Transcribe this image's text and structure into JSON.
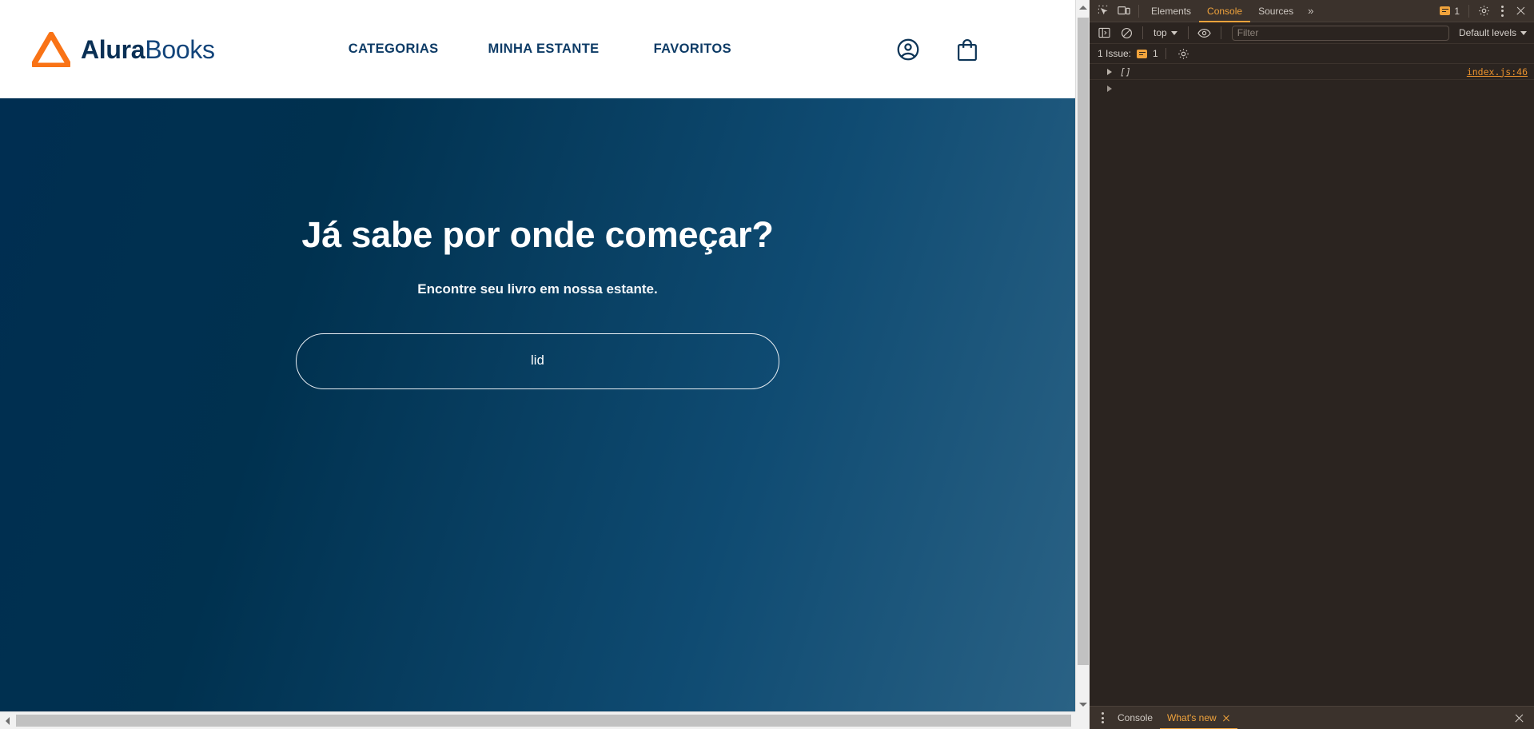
{
  "site": {
    "brand": {
      "part1": "Alura",
      "part2": "Books",
      "logo_icon": "alura-triangle-logo"
    },
    "nav": [
      {
        "label": "CATEGORIAS"
      },
      {
        "label": "MINHA ESTANTE"
      },
      {
        "label": "FAVORITOS"
      }
    ],
    "actions": [
      {
        "icon": "user-account-icon"
      },
      {
        "icon": "shopping-bag-icon"
      }
    ],
    "hero": {
      "title": "Já sabe por onde começar?",
      "subtitle": "Encontre seu livro em nossa estante.",
      "cta_label": "lid",
      "gradient_from": "#002e51",
      "gradient_to": "#2a6285"
    }
  },
  "devtools": {
    "accent": "#f0a33c",
    "background": "#2b2420",
    "toolbar_icons": {
      "inspect": "inspect-element-icon",
      "device": "device-toolbar-icon",
      "settings": "gear-icon",
      "more_options": "kebab-menu-icon",
      "close": "close-icon"
    },
    "tabs": [
      {
        "label": "Elements",
        "active": false
      },
      {
        "label": "Console",
        "active": true
      },
      {
        "label": "Sources",
        "active": false
      }
    ],
    "more_tabs_label": "»",
    "tabbar_issue_count": "1",
    "console_toolbar": {
      "sidebar_icon": "console-sidebar-icon",
      "clear_icon": "clear-console-icon",
      "context_value": "top",
      "eye_icon": "live-expression-eye-icon",
      "filter_placeholder": "Filter",
      "filter_value": "",
      "levels_value": "Default levels"
    },
    "issues_bar": {
      "label": "1 Issue:",
      "count": "1",
      "settings_icon": "gear-icon"
    },
    "console_messages": [
      {
        "value": "[]",
        "source": "index.js:46"
      }
    ],
    "drawer": {
      "tabs": [
        {
          "label": "Console",
          "active": false,
          "closable": false
        },
        {
          "label": "What's new",
          "active": true,
          "closable": true
        }
      ],
      "close_icon": "close-icon",
      "more_icon": "kebab-menu-icon"
    }
  },
  "scrollbars": {
    "vertical": {
      "up_arrow": "scroll-up-arrow",
      "down_arrow": "scroll-down-arrow"
    },
    "horizontal": {
      "left_arrow": "scroll-left-arrow"
    }
  }
}
